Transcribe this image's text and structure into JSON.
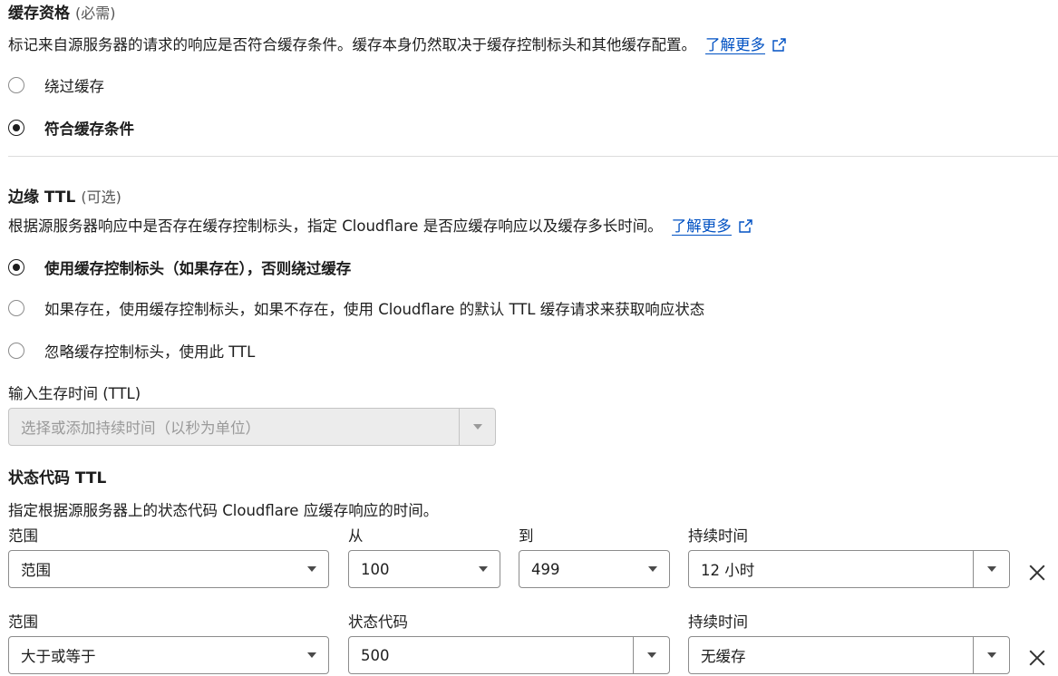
{
  "cache_eligibility": {
    "title": "缓存资格",
    "subtitle": "(必需)",
    "description": "标记来自源服务器的请求的响应是否符合缓存条件。缓存本身仍然取决于缓存控制标头和其他缓存配置。",
    "learn_more": "了解更多",
    "options": [
      {
        "label": "绕过缓存",
        "checked": false
      },
      {
        "label": "符合缓存条件",
        "checked": true
      }
    ]
  },
  "edge_ttl": {
    "title": "边缘 TTL",
    "subtitle": "(可选)",
    "description": "根据源服务器响应中是否存在缓存控制标头，指定 Cloudflare 是否应缓存响应以及缓存多长时间。",
    "learn_more": "了解更多",
    "options": [
      {
        "label": "使用缓存控制标头（如果存在），否则绕过缓存",
        "checked": true
      },
      {
        "label": "如果存在，使用缓存控制标头，如果不存在，使用 Cloudflare 的默认 TTL 缓存请求来获取响应状态",
        "checked": false
      },
      {
        "label": "忽略缓存控制标头，使用此 TTL",
        "checked": false
      }
    ],
    "ttl_input_label": "输入生存时间 (TTL)",
    "ttl_placeholder": "选择或添加持续时间（以秒为单位）"
  },
  "status_code_ttl": {
    "title": "状态代码 TTL",
    "description": "指定根据源服务器上的状态代码 Cloudflare 应缓存响应的时间。",
    "row1": {
      "range_label": "范围",
      "range_value": "范围",
      "from_label": "从",
      "from_value": "100",
      "to_label": "到",
      "to_value": "499",
      "duration_label": "持续时间",
      "duration_value": "12 小时"
    },
    "row2": {
      "range_label": "范围",
      "range_value": "大于或等于",
      "code_label": "状态代码",
      "code_value": "500",
      "duration_label": "持续时间",
      "duration_value": "无缓存"
    }
  },
  "colors": {
    "link": "#0051c3",
    "text": "#1d1d1d",
    "border": "#8c8c8c"
  }
}
